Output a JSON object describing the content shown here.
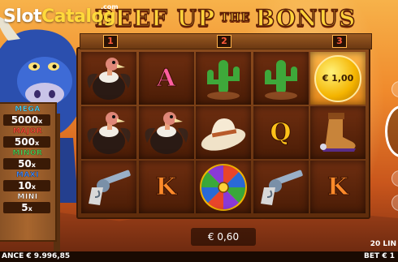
{
  "brand": {
    "part1": "Slot",
    "part2": "Catalog",
    "suffix": ".com"
  },
  "title": {
    "left": "BEEF UP",
    "middle": "THE",
    "right": "BONUS"
  },
  "bonus_levels": [
    "1",
    "2",
    "3"
  ],
  "reels": [
    [
      "vulture",
      "vulture",
      "revolver"
    ],
    [
      "A",
      "vulture",
      "K"
    ],
    [
      "cactus",
      "cowboy-hat",
      "wheel"
    ],
    [
      "cactus",
      "Q",
      "revolver"
    ],
    [
      "coin",
      "boot",
      "K"
    ]
  ],
  "coin_value": "€ 1,00",
  "jackpots": [
    {
      "label": "MEGA",
      "value": "5000",
      "mult": "x",
      "color": "#46d6ff"
    },
    {
      "label": "MAJOR",
      "value": "500",
      "mult": "x",
      "color": "#ff4a3a"
    },
    {
      "label": "MINOR",
      "value": "50",
      "mult": "x",
      "color": "#4ad25a"
    },
    {
      "label": "MAXI",
      "value": "10",
      "mult": "x",
      "color": "#3a8aff"
    },
    {
      "label": "MINI",
      "value": "5",
      "mult": "x",
      "color": "#ffffff"
    }
  ],
  "win_amount": "€ 0,60",
  "lines_label": "20 LIN",
  "balance_label": "ANCE € 9.996,85",
  "bet_label": "BET € 1",
  "colors": {
    "title": "#ffd23a",
    "coin": "#f4b400",
    "frame": "#8a4a1c"
  }
}
